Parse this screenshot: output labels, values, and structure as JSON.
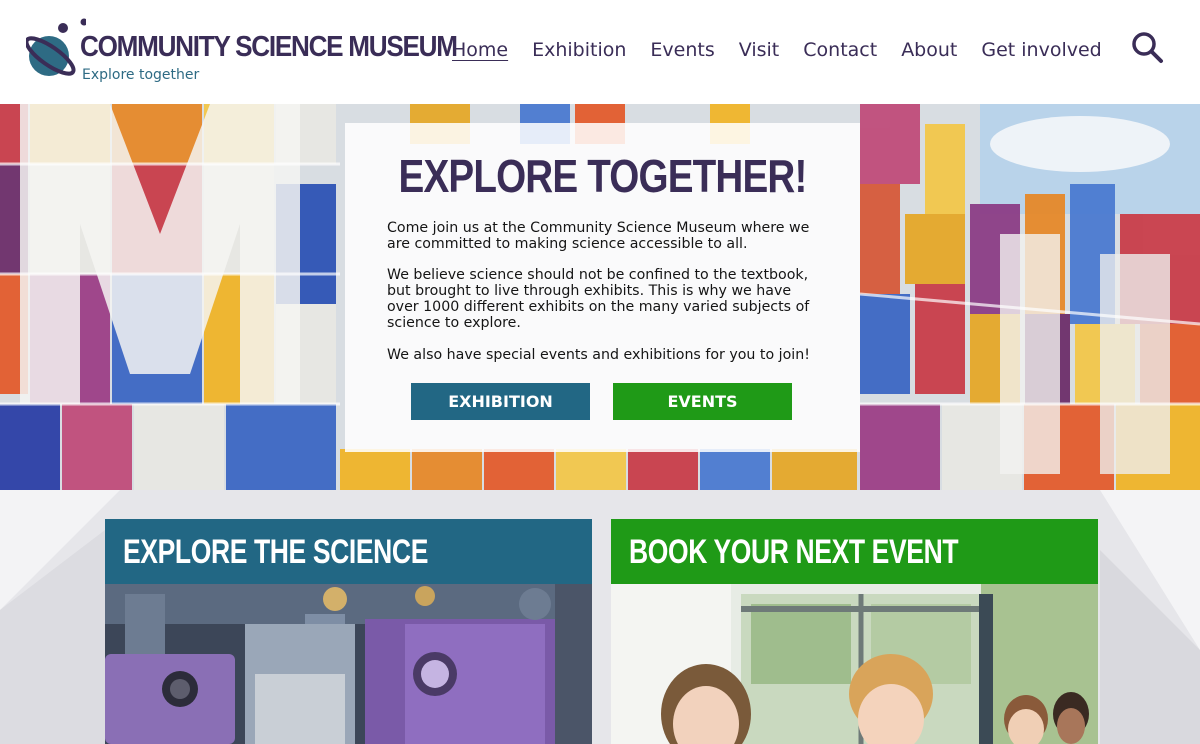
{
  "site": {
    "name": "COMMUNITY SCIENCE MUSEUM",
    "tagline": "Explore together"
  },
  "nav": {
    "items": [
      {
        "label": "Home",
        "active": true
      },
      {
        "label": "Exhibition",
        "active": false
      },
      {
        "label": "Events",
        "active": false
      },
      {
        "label": "Visit",
        "active": false
      },
      {
        "label": "Contact",
        "active": false
      },
      {
        "label": "About",
        "active": false
      },
      {
        "label": "Get involved",
        "active": false
      }
    ],
    "search_icon": "search-icon"
  },
  "hero": {
    "title": "EXPLORE TOGETHER!",
    "paragraph1": "Come join us at the Community Science Museum where we are committed to making science accessible to all.",
    "paragraph2": "We believe science should not be confined to the textbook, but brought to live through exhibits. This is why we have over 1000 different exhibits on the many varied subjects of science to explore.",
    "paragraph3": "We also have special events and exhibitions for you to join!",
    "buttons": {
      "exhibition": "EXHIBITION",
      "events": "EVENTS"
    }
  },
  "cards": {
    "explore": {
      "title": "EXPLORE THE SCIENCE"
    },
    "book": {
      "title": "BOOK YOUR NEXT EVENT"
    }
  },
  "colors": {
    "brand_purple": "#3a2d57",
    "brand_blue": "#226784",
    "brand_green": "#1f9a17"
  }
}
